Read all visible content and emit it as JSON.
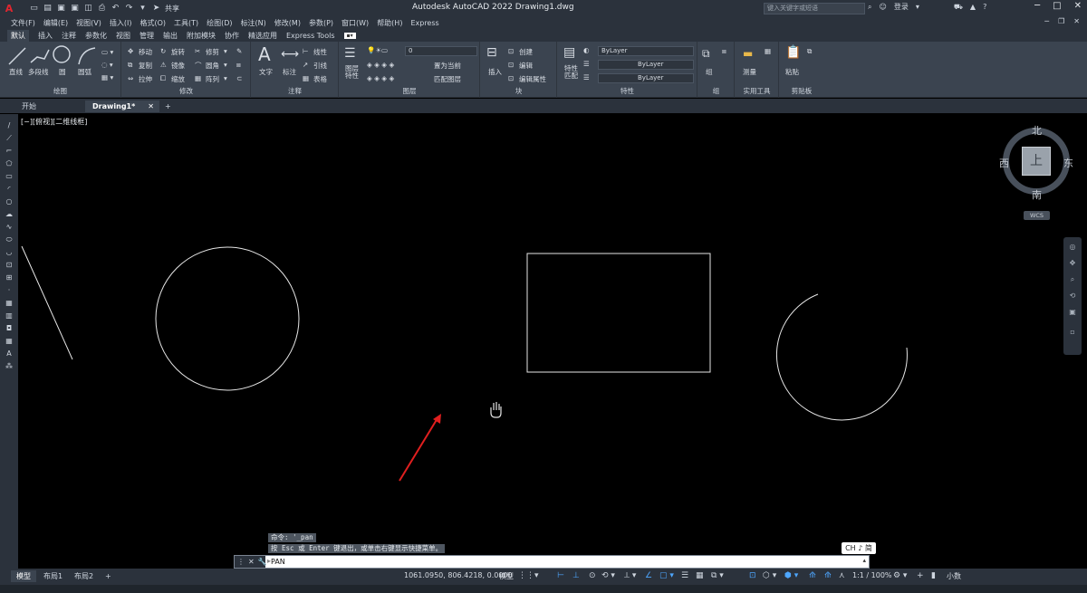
{
  "titlebar": {
    "app_letter": "A",
    "share": "共享",
    "title": "Autodesk AutoCAD 2022    Drawing1.dwg",
    "search_placeholder": "键入关键字或短语",
    "login": "登录",
    "help": "?"
  },
  "menu": [
    "文件(F)",
    "编辑(E)",
    "视图(V)",
    "插入(I)",
    "格式(O)",
    "工具(T)",
    "绘图(D)",
    "标注(N)",
    "修改(M)",
    "参数(P)",
    "窗口(W)",
    "帮助(H)",
    "Express"
  ],
  "ribbon_tabs": [
    "默认",
    "插入",
    "注释",
    "参数化",
    "视图",
    "管理",
    "输出",
    "附加模块",
    "协作",
    "精选应用",
    "Express Tools"
  ],
  "ribbon": {
    "draw": {
      "line": "直线",
      "polyline": "多段线",
      "circle": "圆",
      "arc": "圆弧",
      "group": "绘图"
    },
    "modify": {
      "move": "移动",
      "rotate": "旋转",
      "trim": "修剪",
      "copy": "复制",
      "mirror": "镜像",
      "fillet": "圆角",
      "stretch": "拉伸",
      "scale": "缩放",
      "array": "阵列",
      "group": "修改"
    },
    "annotation": {
      "text": "文字",
      "dimension": "标注",
      "linear": "线性",
      "leader": "引线",
      "table": "表格",
      "group": "注释"
    },
    "layers": {
      "layer_props": "图层\n特性",
      "layer_value": "0",
      "make_current": "置为当前",
      "match_layer": "匹配图层",
      "group": "图层"
    },
    "block": {
      "insert": "插入",
      "create": "创建",
      "edit": "编辑",
      "edit_attr": "编辑属性",
      "group": "块"
    },
    "properties": {
      "match": "特性\n匹配",
      "color": "ByLayer",
      "linetype": "ByLayer",
      "lineweight": "ByLayer",
      "group": "特性"
    },
    "groups": {
      "group": "组",
      "group_label": "组"
    },
    "utilities": {
      "measure": "测量",
      "group": "实用工具"
    },
    "clipboard": {
      "paste": "粘贴",
      "group": "剪贴板"
    }
  },
  "doc_tabs": {
    "start": "开始",
    "drawing": "Drawing1*",
    "close": "✕",
    "add": "+"
  },
  "viewport": {
    "label": "[−][俯视][二维线框]",
    "compass": {
      "north": "北",
      "south": "南",
      "east": "东",
      "west": "西",
      "face": "上"
    },
    "wcs": "WCS"
  },
  "ime": "CH ♪ 简",
  "command": {
    "hist1": "命令: '_pan",
    "hist2": "按 Esc 或 Enter 键退出，或单击右键显示快捷菜单。",
    "input": "PAN"
  },
  "status": {
    "layout_tabs": [
      "模型",
      "布局1",
      "布局2"
    ],
    "add": "+",
    "coords": "1061.0950, 806.4218, 0.0000",
    "model": "模型",
    "scale": "1:1 / 100%",
    "decimal": "小数"
  },
  "accent": "#4ea7ff",
  "annotation_arrow_color": "#e01f1f"
}
